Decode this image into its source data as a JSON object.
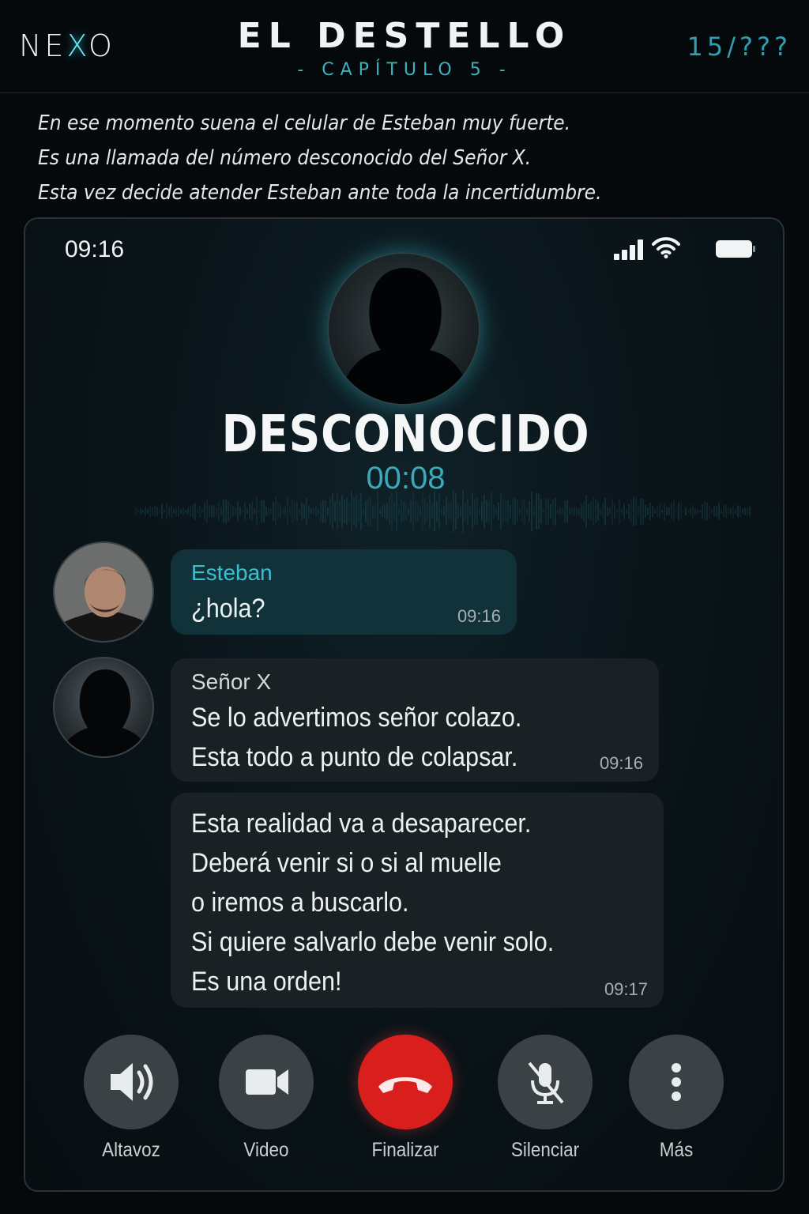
{
  "header": {
    "logo_prefix": "NE",
    "logo_x": "X",
    "logo_suffix": "O",
    "title": "EL DESTELLO",
    "chapter": "- CAPÍTULO 5 -",
    "page_counter": "15/???"
  },
  "narration": [
    "En ese momento suena el celular de Esteban muy fuerte.",
    "Es una llamada del número desconocido del Señor X.",
    "Esta vez decide atender Esteban ante toda la incertidumbre."
  ],
  "status_bar": {
    "time": "09:16",
    "icons": [
      "signal-icon",
      "wifi-icon",
      "battery-icon"
    ]
  },
  "call": {
    "caller_name": "DESCONOCIDO",
    "duration": "00:08"
  },
  "messages": [
    {
      "sender": "Esteban",
      "lines": [
        "¿hola?"
      ],
      "time": "09:16"
    },
    {
      "sender": "Señor X",
      "lines": [
        "Se lo advertimos señor colazo.",
        "Esta todo a punto de colapsar."
      ],
      "time": "09:16"
    },
    {
      "sender": "",
      "lines": [
        "Esta realidad va a desaparecer.",
        "Deberá venir si o si al muelle",
        "o iremos a buscarlo.",
        "Si quiere salvarlo debe venir solo.",
        "Es una orden!"
      ],
      "time": "09:17"
    }
  ],
  "controls": {
    "speaker": "Altavoz",
    "video": "Video",
    "end": "Finalizar",
    "mute": "Silenciar",
    "more": "Más"
  },
  "colors": {
    "background": "#05090b",
    "accent": "#3ac0cf",
    "end_call": "#d91e1e",
    "control_button": "#3b4246",
    "my_bubble": "#113238",
    "other_bubble": "#1a2125"
  }
}
